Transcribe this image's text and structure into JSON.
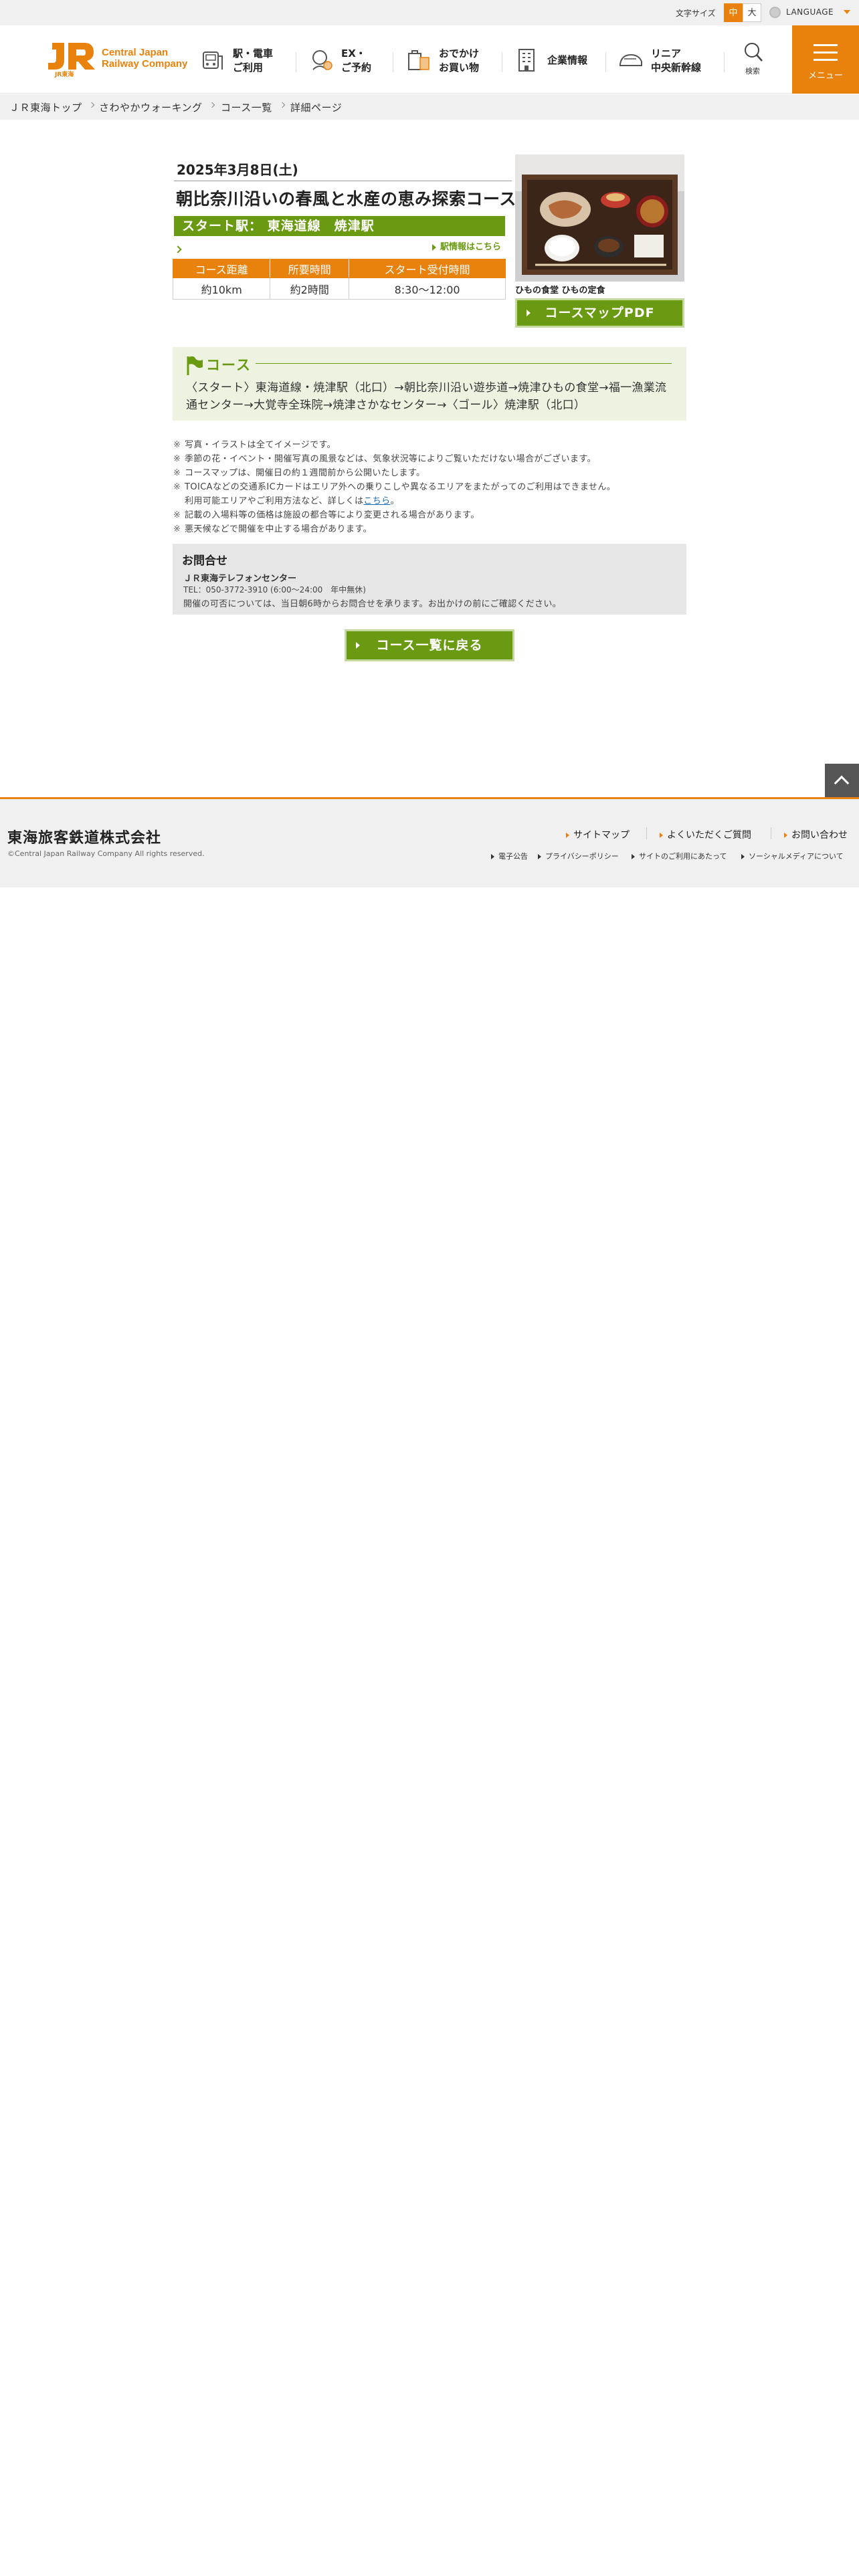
{
  "utility": {
    "font_size_label": "文字サイズ",
    "font_mid": "中",
    "font_large": "大",
    "language": "LANGUAGE"
  },
  "header": {
    "logo_name": "Central Japan\nRailway Company",
    "logo_sub": "JR東海",
    "nav": [
      {
        "label": "駅・電車\nご利用",
        "icon": "train-station-icon"
      },
      {
        "label": "EX・\nご予約",
        "icon": "reservation-icon"
      },
      {
        "label": "おでかけ\nお買い物",
        "icon": "shopping-icon"
      },
      {
        "label": "企業情報",
        "icon": "building-icon"
      },
      {
        "label": "リニア\n中央新幹線",
        "icon": "maglev-icon"
      }
    ],
    "search_label": "検索",
    "menu_label": "メニュー"
  },
  "breadcrumb": [
    "ＪＲ東海トップ",
    "さわやかウォーキング",
    "コース一覧",
    "詳細ページ"
  ],
  "event": {
    "date": "2025年3月8日(土)",
    "title": "朝比奈川沿いの春風と水産の恵み探索コース",
    "start_station": "スタート駅：  東海道線　焼津駅",
    "station_info_link": "駅情報はこちら",
    "table_headers": [
      "コース距離",
      "所要時間",
      "スタート受付時間"
    ],
    "table_values": [
      "約10km",
      "約2時間",
      "8:30〜12:00"
    ],
    "photo_caption": "ひもの食堂 ひもの定食",
    "pdf_button": "コースマップPDF"
  },
  "course": {
    "label": "コース",
    "route": "〈スタート〉東海道線・焼津駅（北口）→朝比奈川沿い遊歩道→焼津ひもの食堂→福一漁業流通センター→大覚寺全珠院→焼津さかなセンター→〈ゴール〉焼津駅（北口）"
  },
  "notes": {
    "mark": "※",
    "items": [
      "写真・イラストは全てイメージです。",
      "季節の花・イベント・開催写真の風景などは、気象状況等によりご覧いただけない場合がございます。",
      "コースマップは、開催日の約１週間前から公開いたします。",
      "TOICAなどの交通系ICカードはエリア外への乗りこしや異なるエリアをまたがってのご利用はできません。"
    ],
    "toica_cont": "利用可能エリアやご利用方法など、詳しくは",
    "toica_link": "こちら",
    "toica_end": "。",
    "items2": [
      "記載の入場料等の価格は施設の都合等により変更される場合があります。",
      "悪天候などで開催を中止する場合があります。"
    ]
  },
  "contact": {
    "heading": "お問合せ",
    "org": "ＪＲ東海テレフォンセンター",
    "tel": "TEL：050-3772-3910 (6:00〜24:00　年中無休)",
    "message": "開催の可否については、当日朝6時からお問合せを承ります。お出かけの前にご確認ください。"
  },
  "back_button": "コース一覧に戻る",
  "footer": {
    "corp_name": "東海旅客鉄道株式会社",
    "copyright": "©Central Japan Railway Company All rights reserved.",
    "links": [
      "サイトマップ",
      "よくいただくご質問",
      "お問い合わせ"
    ],
    "sub_links": [
      "電子公告",
      "プライバシーポリシー",
      "サイトのご利用にあたって",
      "ソーシャルメディアについて"
    ]
  },
  "colors": {
    "brand_orange": "#e8820c",
    "course_green": "#6a9a12",
    "course_box_bg": "#eef3e1"
  }
}
